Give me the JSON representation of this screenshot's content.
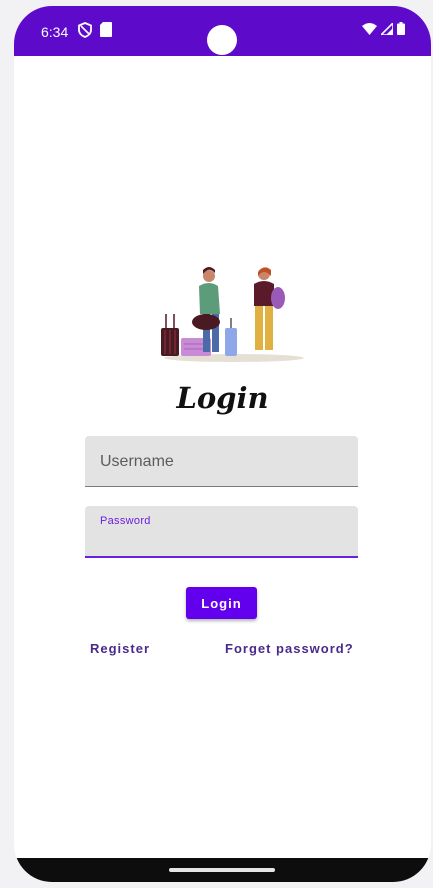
{
  "status_bar": {
    "time": "6:34",
    "icons": [
      "vpn-shield-icon",
      "sd-card-icon",
      "wifi-icon",
      "signal-icon",
      "battery-icon"
    ],
    "color": "#5e0acb"
  },
  "login": {
    "title": "Login",
    "username_placeholder": "Username",
    "password_label": "Password",
    "login_button": "Login",
    "register_link": "Register",
    "forget_link": "Forget password?"
  },
  "colors": {
    "accent": "#6200ee",
    "field_bg": "#e3e3e3",
    "link": "#4a2a8a"
  }
}
